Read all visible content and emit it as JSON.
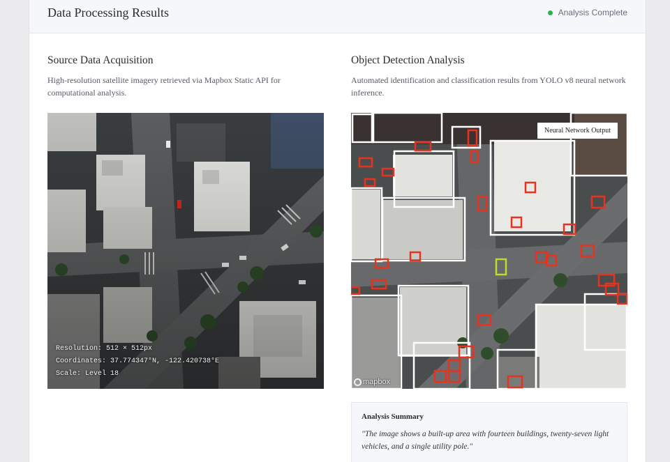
{
  "header": {
    "title": "Data Processing Results",
    "status": "Analysis Complete",
    "status_color": "#2bb24c"
  },
  "source": {
    "title": "Source Data Acquisition",
    "description": "High-resolution satellite imagery retrieved via Mapbox Static API for computational analysis.",
    "overlay": {
      "resolution": "Resolution: 512 × 512px",
      "coordinates": "Coordinates: 37.774347°N, -122.420738°E",
      "scale": "Scale: Level 18"
    },
    "logo": "mapbox"
  },
  "detection": {
    "title": "Object Detection Analysis",
    "description": "Automated identification and classification results from YOLO v8 neural network inference.",
    "badge": "Neural Network Output",
    "logo": "mapbox",
    "box_colors": {
      "building": "#ffffff",
      "vehicle": "#e8321e",
      "pole": "#b8e02a"
    }
  },
  "summary": {
    "title": "Analysis Summary",
    "text": "\"The image shows a built-up area with fourteen buildings, twenty-seven light vehicles, and a single utility pole.\""
  }
}
